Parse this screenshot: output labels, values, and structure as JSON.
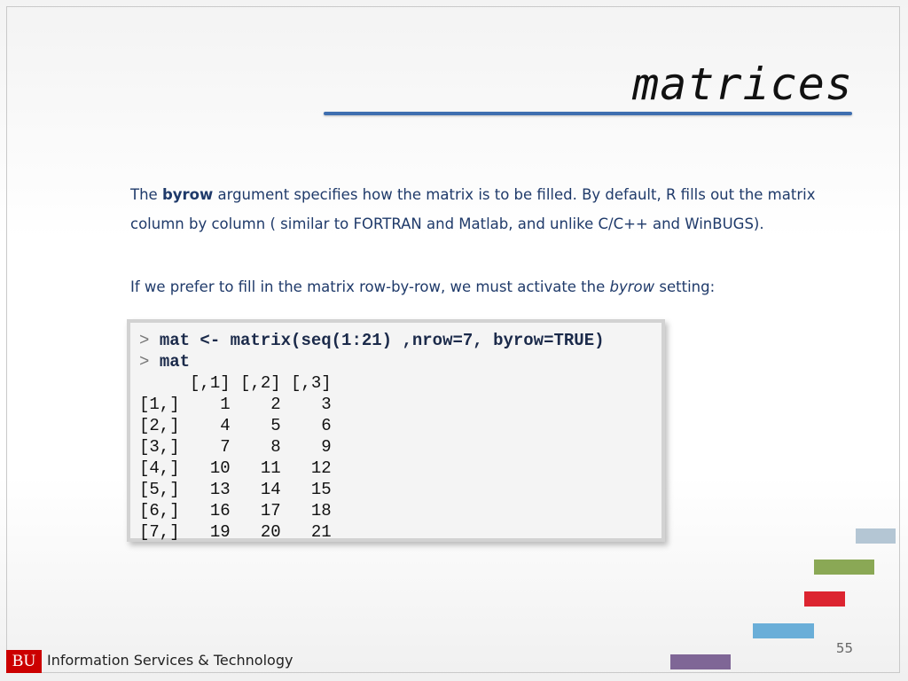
{
  "slide": {
    "title": "matrices",
    "page_number": "55"
  },
  "paragraph1": {
    "before": "The ",
    "keyword": "byrow",
    "after": " argument specifies how the matrix is to be filled. By default, R fills out the matrix column by column ( similar to FORTRAN and Matlab, and unlike C/C++ and WinBUGS)."
  },
  "paragraph2": {
    "before": "If we prefer to fill in the matrix row-by-row, we must activate the ",
    "keyword": "byrow",
    "after": " setting:"
  },
  "code": {
    "prompt": ">",
    "command1": "mat <- matrix(seq(1:21) ,nrow=7, byrow=TRUE)",
    "command2": "mat",
    "header": "     [,1] [,2] [,3]",
    "rows": [
      "[1,]    1    2    3",
      "[2,]    4    5    6",
      "[3,]    7    8    9",
      "[4,]   10   11   12",
      "[5,]   13   14   15",
      "[6,]   16   17   18",
      "[7,]   19   20   21"
    ]
  },
  "footer": {
    "logo": "BU",
    "org": "Information Services & Technology"
  },
  "colors": {
    "title_rule": "#3f6fb0",
    "text": "#1f3a6a",
    "logo_red": "#cc0000",
    "deco_gray": "#b4c6d4",
    "deco_green": "#8aa855",
    "deco_red": "#dc2430",
    "deco_blue": "#6aaed8",
    "deco_purple": "#7f6696"
  }
}
